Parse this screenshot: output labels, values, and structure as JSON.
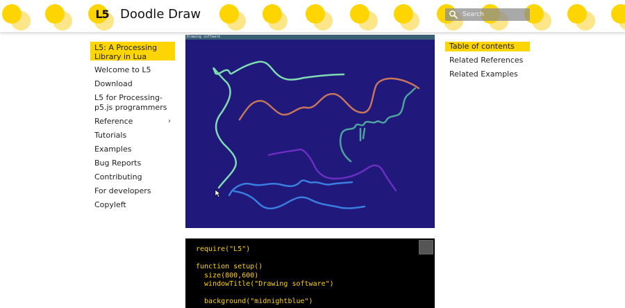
{
  "header": {
    "logo_text": "L5",
    "title": "Doodle Draw",
    "search_placeholder": "Search"
  },
  "sidebar": {
    "active": "L5: A Processing Library in Lua",
    "items": [
      {
        "label": "Welcome to L5"
      },
      {
        "label": "Download"
      },
      {
        "label": "L5 for Processing-p5.js programmers"
      },
      {
        "label": "Reference",
        "chevron": "›"
      },
      {
        "label": "Tutorials"
      },
      {
        "label": "Examples"
      },
      {
        "label": "Bug Reports"
      },
      {
        "label": "Contributing"
      },
      {
        "label": "For developers"
      },
      {
        "label": "Copyleft"
      }
    ]
  },
  "toc": {
    "title": "Table of contents",
    "links": [
      "Related References",
      "Related Examples"
    ]
  },
  "screenshot": {
    "window_title": "Drawing software",
    "background": "#20187a"
  },
  "code": {
    "lines": [
      "require(\"L5\")",
      "",
      "function setup()",
      "  size(800,600)",
      "  windowTitle(\"Drawing software\")",
      "",
      "  background(\"midnightblue\")"
    ]
  },
  "colors": {
    "accent": "#ffd500",
    "code_bg": "#000000",
    "code_text": "#ffd500"
  }
}
